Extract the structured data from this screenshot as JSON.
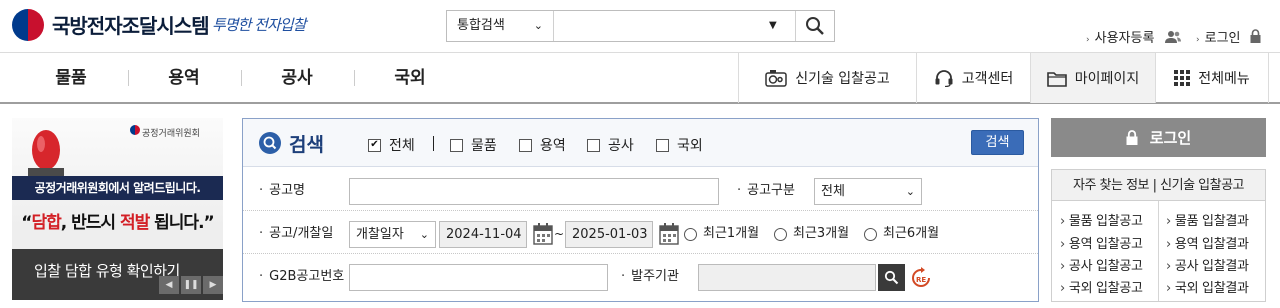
{
  "header": {
    "brand": "국방전자조달시스템",
    "slogan": "투명한 전자입찰",
    "search": {
      "scope": "통합검색",
      "placeholder": ""
    },
    "util": {
      "register": "사용자등록",
      "login": "로그인"
    }
  },
  "gnb": {
    "items": [
      "물품",
      "용역",
      "공사",
      "국외"
    ],
    "quick": [
      {
        "label": "신기술 입찰공고",
        "icon": "new-tech-icon"
      },
      {
        "label": "고객센터",
        "icon": "headset-icon"
      },
      {
        "label": "마이페이지",
        "icon": "folder-icon"
      },
      {
        "label": "전체메뉴",
        "icon": "grid-menu-icon"
      }
    ]
  },
  "banner": {
    "org": "공정거래위원회",
    "headline": "공정거래위원회에서 알려드립니다.",
    "slogan_a": "담합",
    "slogan_b": ", 반드시 ",
    "slogan_c": "적발",
    "slogan_d": " 됩니다.",
    "link": "입찰 담합 유형 확인하기",
    "colors": {
      "band": "#1b2a52",
      "accent": "#d31f25"
    }
  },
  "search_panel": {
    "title": "검색",
    "checks": [
      {
        "label": "전체",
        "checked": true
      },
      {
        "label": "물품",
        "checked": false
      },
      {
        "label": "용역",
        "checked": false
      },
      {
        "label": "공사",
        "checked": false
      },
      {
        "label": "국외",
        "checked": false
      }
    ],
    "search_button": "검색",
    "rows": {
      "notice_name": {
        "label": "공고명",
        "value": ""
      },
      "notice_type": {
        "label": "공고구분",
        "value": "전체"
      },
      "date": {
        "label": "공고/개찰일",
        "date_type": "개찰일자",
        "from": "2024-11-04",
        "tilde": "~",
        "to": "2025-01-03",
        "ranges": [
          "최근1개월",
          "최근3개월",
          "최근6개월"
        ]
      },
      "g2b": {
        "label": "G2B공고번호",
        "value": ""
      },
      "agency": {
        "label": "발주기관",
        "value": ""
      }
    }
  },
  "sidebar": {
    "login": "로그인",
    "faq_title": "자주 찾는 정보 | 신기술 입찰공고",
    "left_links": [
      "물품 입찰공고",
      "용역 입찰공고",
      "공사 입찰공고",
      "국외 입찰공고"
    ],
    "right_links": [
      "물품 입찰결과",
      "용역 입찰결과",
      "공사 입찰결과",
      "국외 입찰결과"
    ]
  }
}
